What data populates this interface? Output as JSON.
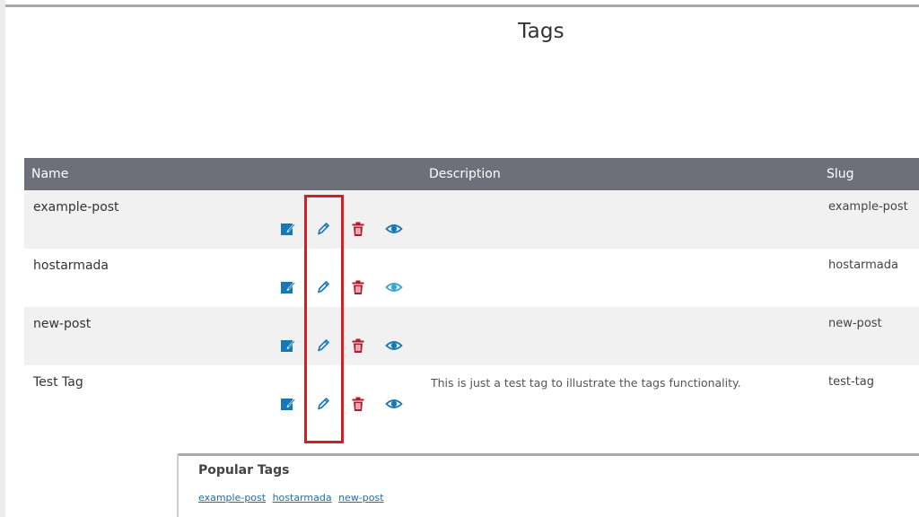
{
  "page": {
    "title": "Tags"
  },
  "table": {
    "headers": {
      "name": "Name",
      "description": "Description",
      "slug": "Slug"
    },
    "rows": [
      {
        "name": "example-post",
        "description": "",
        "slug": "example-post"
      },
      {
        "name": "hostarmada",
        "description": "",
        "slug": "hostarmada"
      },
      {
        "name": "new-post",
        "description": "",
        "slug": "new-post"
      },
      {
        "name": "Test Tag",
        "description": "This is just a test tag to illustrate the tags functionality.",
        "slug": "test-tag"
      }
    ],
    "action_icons": [
      "quick-edit-icon",
      "pencil-icon",
      "trash-icon",
      "eye-icon"
    ]
  },
  "popular": {
    "title": "Popular Tags",
    "tags": [
      "example-post",
      "hostarmada",
      "new-post"
    ]
  },
  "colors": {
    "header_bg": "#6e7079",
    "row_alt_bg": "#f1f1f1",
    "icon_blue": "#1678b7",
    "icon_red": "#b3192a",
    "eye_blue_light": "#3aa4d2",
    "highlight_red": "#d31f1f",
    "link_blue": "#1e6fa0"
  }
}
